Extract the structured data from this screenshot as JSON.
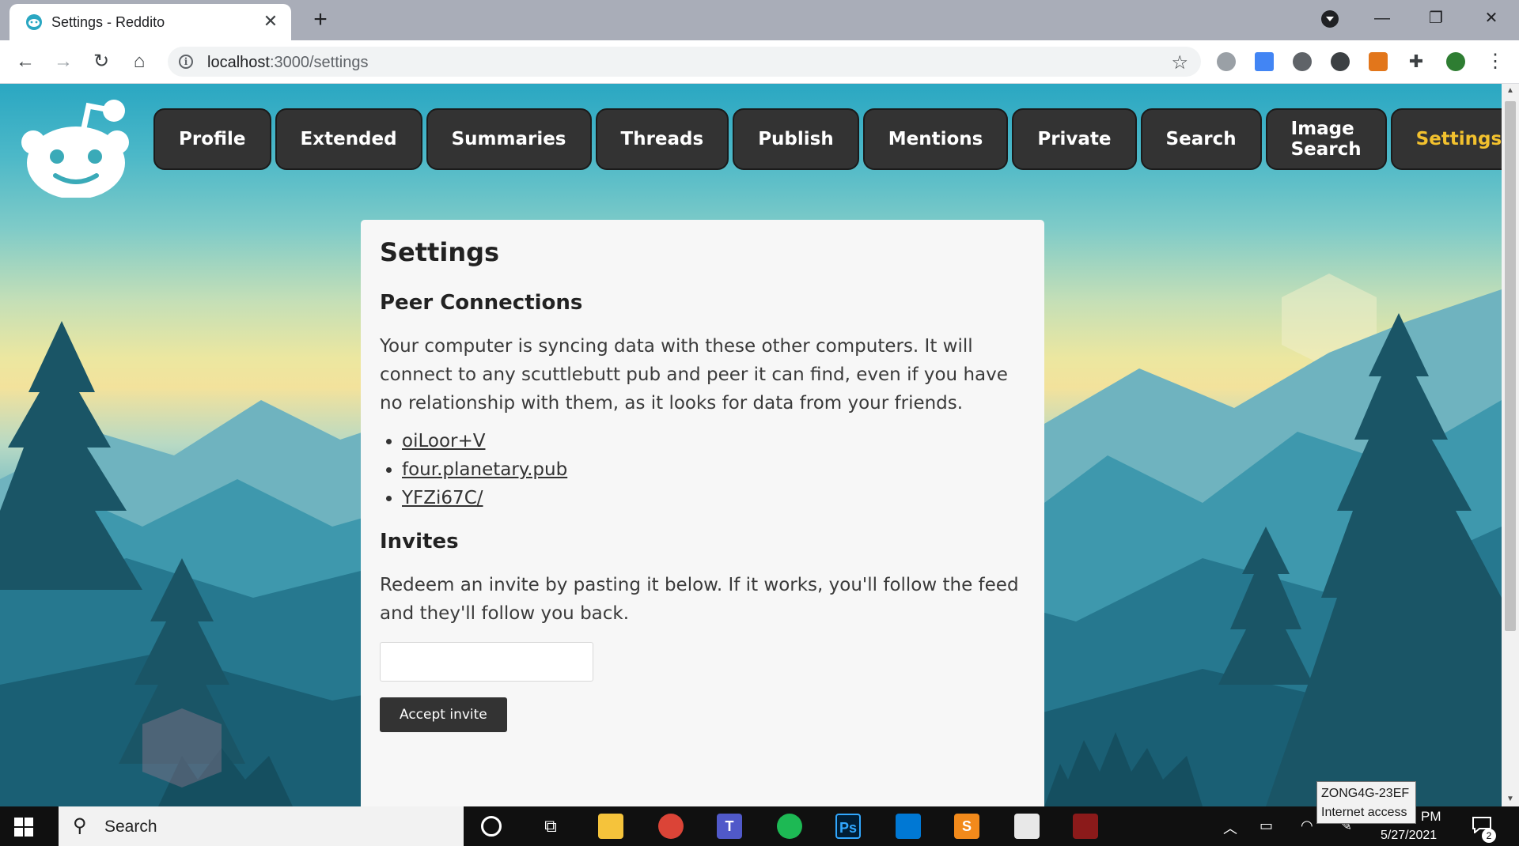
{
  "browser": {
    "tab_title": "Settings - Reddito",
    "url_host": "localhost",
    "url_path": ":3000/settings",
    "icons": {
      "back": "arrow-left-icon",
      "forward": "arrow-right-icon",
      "reload": "reload-icon",
      "home": "home-icon",
      "info": "info-icon",
      "bookmark": "star-icon",
      "extensions": "puzzle-icon",
      "menu": "kebab-menu-icon"
    }
  },
  "nav": {
    "items": [
      {
        "label": "Profile"
      },
      {
        "label": "Extended"
      },
      {
        "label": "Summaries"
      },
      {
        "label": "Threads"
      },
      {
        "label": "Publish"
      },
      {
        "label": "Mentions"
      },
      {
        "label": "Private"
      },
      {
        "label": "Search"
      },
      {
        "label": "Image Search"
      },
      {
        "label": "Settings",
        "active": true
      }
    ],
    "active_color": "#f2c12e"
  },
  "settings": {
    "title": "Settings",
    "peers": {
      "heading": "Peer Connections",
      "description": "Your computer is syncing data with these other computers. It will connect to any scuttlebutt pub and peer it can find, even if you have no relationship with them, as it looks for data from your friends.",
      "list": [
        "oiLoor+V",
        "four.planetary.pub",
        "YFZi67C/"
      ]
    },
    "invites": {
      "heading": "Invites",
      "description": "Redeem an invite by pasting it below. If it works, you'll follow the feed and they'll follow you back.",
      "input_value": "",
      "button_label": "Accept invite"
    }
  },
  "taskbar": {
    "search_label": "Search",
    "clock_time": "PM",
    "clock_date": "5/27/2021",
    "notification_count": "2",
    "wifi_tooltip_name": "ZONG4G-23EF",
    "wifi_tooltip_status": "Internet access"
  },
  "colors": {
    "nav_pill_bg": "#333333",
    "card_bg": "#f7f7f7",
    "button_bg": "#333333"
  }
}
